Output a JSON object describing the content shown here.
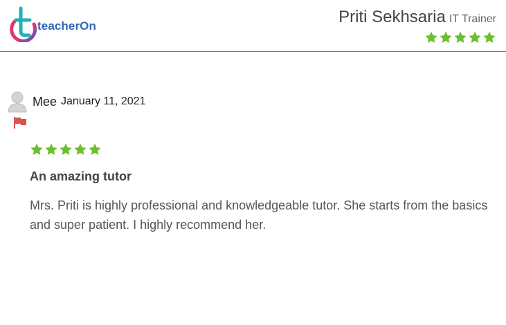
{
  "brand": {
    "logo_text": "teacherOn",
    "colors": {
      "logo_text": "#2f66b8",
      "logo_teal": "#21b0b8",
      "logo_pink": "#e6336f",
      "logo_blue": "#3b5fc4"
    }
  },
  "tutor": {
    "name": "Priti Sekhsaria",
    "role": "IT Trainer",
    "rating": 5,
    "max_rating": 5
  },
  "review": {
    "reviewer_name": "Mee",
    "date": "January 11, 2021",
    "rating": 5,
    "max_rating": 5,
    "title": "An amazing tutor",
    "body": "Mrs. Priti is highly professional and knowledgeable tutor. She starts from the basics and super patient. I highly recommend her."
  },
  "icons": {
    "avatar": "user-avatar-icon",
    "flag": "report-flag-icon",
    "star": "star-icon"
  },
  "colors": {
    "star": "#6cbf2e",
    "flag": "#d9534f",
    "divider": "#7a7a7a",
    "avatar": "#c8c8c8"
  }
}
